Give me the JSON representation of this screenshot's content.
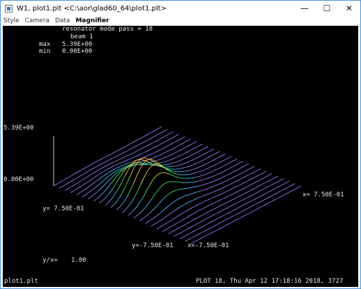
{
  "window": {
    "title": "W1, plot1.plt <C:\\aor\\glad60_64\\plot1.plt>",
    "buttons": {
      "minimize": "—",
      "maximize": "☐",
      "close": "✕"
    }
  },
  "menu": {
    "items": [
      "Style",
      "Camera",
      "Data",
      "Magnifier"
    ]
  },
  "plot": {
    "header": "resonator mode pass = 18",
    "beam": "beam 1",
    "max_label": "max",
    "max_value": "5.39E+00",
    "min_label": "min",
    "min_value": "0.00E+00",
    "z_top_label": "5.39E+00",
    "z_bottom_label": "0.00E+00",
    "x_right_label": "x= 7.50E-01",
    "y_left_label": "y= 7.50E-01",
    "y_bottom_label": "y=-7.50E-01",
    "x_bottom_label": "x=-7.50E-01",
    "ratio_label": "y/x=",
    "ratio_value": "1.00",
    "file_label": "plot1.plt",
    "footer": "PLOT 18, Thu Apr 12 17:18:16 2018, 3727"
  },
  "colors": {
    "background": "#000000",
    "text": "#e6e6e6",
    "mesh_base": "#8f7dff",
    "axis": "#d0d0d0",
    "peak": "#ff4040"
  }
}
